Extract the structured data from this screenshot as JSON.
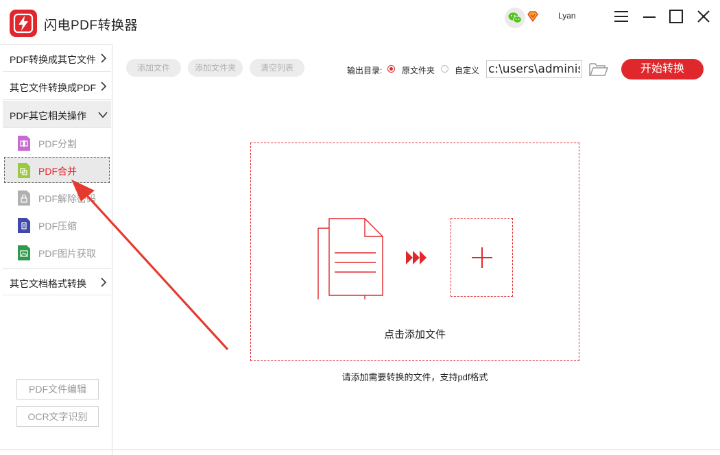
{
  "app": {
    "title": "闪电PDF转换器",
    "username": "Lyan",
    "accent_color": "#e0282c"
  },
  "icons": {
    "logo": "lightning-logo-icon",
    "wechat": "wechat-icon",
    "vip": "vip-diamond-icon",
    "menu": "hamburger-menu-icon",
    "minimize": "minimize-icon",
    "maximize": "maximize-icon",
    "close": "close-icon",
    "folder": "folder-open-icon",
    "chevron": "chevron-icon"
  },
  "sidebar": {
    "categories": [
      {
        "label": "PDF转换成其它文件",
        "expanded": false
      },
      {
        "label": "其它文件转换成PDF",
        "expanded": false
      },
      {
        "label": "PDF其它相关操作",
        "expanded": true
      },
      {
        "label": "其它文档格式转换",
        "expanded": false
      }
    ],
    "items": [
      {
        "label": "PDF分割",
        "icon": "pdf-split-icon",
        "color": "#c56ccf",
        "active": false
      },
      {
        "label": "PDF合并",
        "icon": "pdf-merge-icon",
        "color": "#9bc93f",
        "active": true
      },
      {
        "label": "PDF解除密码",
        "icon": "pdf-unlock-icon",
        "color": "#b0b0b0",
        "active": false
      },
      {
        "label": "PDF压缩",
        "icon": "pdf-compress-icon",
        "color": "#3f4aa8",
        "active": false
      },
      {
        "label": "PDF图片获取",
        "icon": "pdf-image-extract-icon",
        "color": "#2e9a4e",
        "active": false
      }
    ],
    "bottom_buttons": [
      "PDF文件编辑",
      "OCR文字识别"
    ]
  },
  "toolbar": {
    "add_file": "添加文件",
    "add_folder": "添加文件夹",
    "clear_list": "清空列表",
    "output_label": "输出目录:",
    "radio_original": "原文件夹",
    "radio_custom": "自定义",
    "selected_output": "原文件夹",
    "path_value": "c:\\users\\administ",
    "start": "开始转换"
  },
  "dropzone": {
    "text": "点击添加文件",
    "hint": "请添加需要转换的文件，支持pdf格式"
  }
}
